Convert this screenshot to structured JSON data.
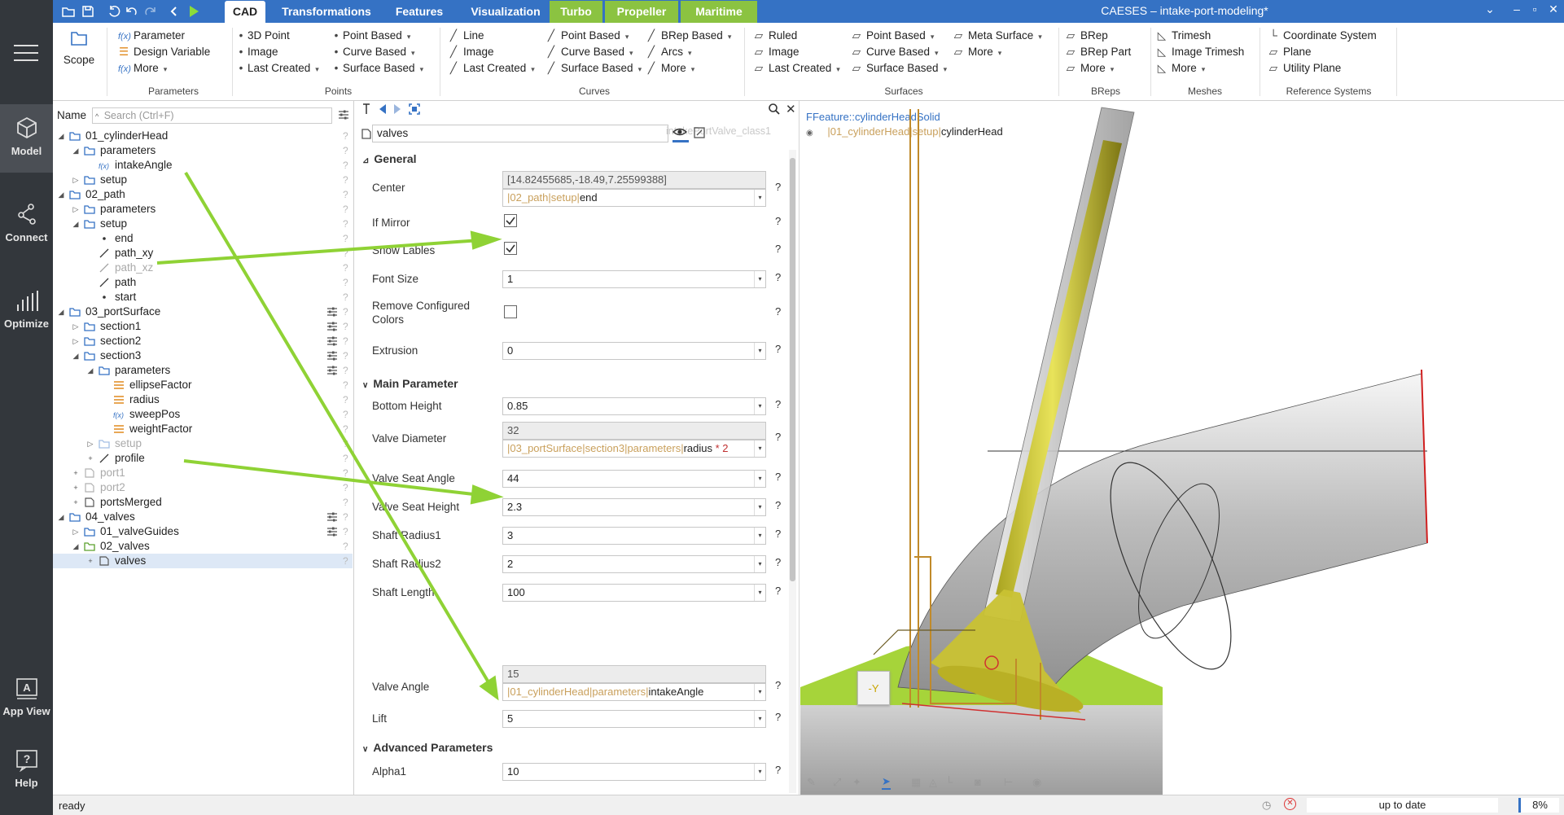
{
  "rail": {
    "items": [
      {
        "label": "Model",
        "icon": "cube-icon"
      },
      {
        "label": "Connect",
        "icon": "connect-icon"
      },
      {
        "label": "Optimize",
        "icon": "chart-icon"
      },
      {
        "label": "App View",
        "icon": "app-view-icon"
      },
      {
        "label": "Help",
        "icon": "help-icon"
      }
    ]
  },
  "titlebar": {
    "tabs": [
      "CAD",
      "Transformations",
      "Features",
      "Visualization",
      "Turbo",
      "Propeller",
      "Maritime"
    ],
    "title": "CAESES – intake-port-modeling*"
  },
  "ribbon": {
    "scope": "Scope",
    "params": {
      "parameter": "Parameter",
      "design_variable": "Design Variable",
      "more": "More",
      "group": "Parameters"
    },
    "points": {
      "p3d": "3D Point",
      "image": "Image",
      "last_created": "Last Created",
      "point_based": "Point Based",
      "curve_based": "Curve Based",
      "surface_based": "Surface Based",
      "group": "Points"
    },
    "curves": {
      "line": "Line",
      "image": "Image",
      "last_created": "Last Created",
      "point_based": "Point Based",
      "curve_based": "Curve Based",
      "surface_based": "Surface Based",
      "brep_based": "BRep Based",
      "arcs": "Arcs",
      "more": "More",
      "group": "Curves"
    },
    "surfaces": {
      "ruled": "Ruled",
      "image": "Image",
      "last_created": "Last Created",
      "point_based": "Point Based",
      "curve_based": "Curve Based",
      "surface_based": "Surface Based",
      "meta_surface": "Meta Surface",
      "more": "More",
      "group": "Surfaces"
    },
    "breps": {
      "brep": "BRep",
      "brep_part": "BRep Part",
      "more": "More",
      "group": "BReps"
    },
    "meshes": {
      "trimesh": "Trimesh",
      "image_trimesh": "Image Trimesh",
      "more": "More",
      "group": "Meshes"
    },
    "refsys": {
      "coordinate_system": "Coordinate System",
      "plane": "Plane",
      "utility_plane": "Utility Plane",
      "group": "Reference Systems"
    }
  },
  "tree": {
    "name_label": "Name",
    "search_placeholder": "Search (Ctrl+F)",
    "rows": [
      {
        "label": "01_cylinderHead",
        "icon": "folder-icon",
        "level": 0,
        "arrow": "expanded",
        "dim": false,
        "sliders": false
      },
      {
        "label": "parameters",
        "icon": "folder-icon",
        "level": 1,
        "arrow": "expanded",
        "dim": false,
        "sliders": false
      },
      {
        "label": "intakeAngle",
        "icon": "function-icon",
        "level": 2,
        "arrow": "none",
        "dim": false,
        "sliders": false
      },
      {
        "label": "setup",
        "icon": "folder-icon",
        "level": 1,
        "arrow": "collapsed",
        "dim": false,
        "sliders": false
      },
      {
        "label": "02_path",
        "icon": "folder-icon",
        "level": 0,
        "arrow": "expanded",
        "dim": false,
        "sliders": false
      },
      {
        "label": "parameters",
        "icon": "folder-icon",
        "level": 1,
        "arrow": "collapsed",
        "dim": false,
        "sliders": false
      },
      {
        "label": "setup",
        "icon": "folder-icon",
        "level": 1,
        "arrow": "expanded",
        "dim": false,
        "sliders": false
      },
      {
        "label": "end",
        "icon": "point-icon",
        "level": 2,
        "arrow": "none",
        "dim": false,
        "sliders": false
      },
      {
        "label": "path_xy",
        "icon": "curve-icon",
        "level": 2,
        "arrow": "none",
        "dim": false,
        "sliders": false
      },
      {
        "label": "path_xz",
        "icon": "curve-icon",
        "level": 2,
        "arrow": "none",
        "dim": true,
        "sliders": false
      },
      {
        "label": "path",
        "icon": "curve-icon",
        "level": 2,
        "arrow": "none",
        "dim": false,
        "sliders": false
      },
      {
        "label": "start",
        "icon": "point-icon",
        "level": 2,
        "arrow": "none",
        "dim": false,
        "sliders": false
      },
      {
        "label": "03_portSurface",
        "icon": "folder-icon",
        "level": 0,
        "arrow": "expanded",
        "dim": false,
        "sliders": true
      },
      {
        "label": "section1",
        "icon": "folder-icon",
        "level": 1,
        "arrow": "collapsed",
        "dim": false,
        "sliders": true
      },
      {
        "label": "section2",
        "icon": "folder-icon",
        "level": 1,
        "arrow": "collapsed",
        "dim": false,
        "sliders": true
      },
      {
        "label": "section3",
        "icon": "folder-icon",
        "level": 1,
        "arrow": "expanded",
        "dim": false,
        "sliders": true
      },
      {
        "label": "parameters",
        "icon": "folder-icon",
        "level": 2,
        "arrow": "expanded",
        "dim": false,
        "sliders": true
      },
      {
        "label": "ellipseFactor",
        "icon": "design-variable-icon",
        "level": 3,
        "arrow": "none",
        "dim": false,
        "sliders": false
      },
      {
        "label": "radius",
        "icon": "design-variable-icon",
        "level": 3,
        "arrow": "none",
        "dim": false,
        "sliders": false
      },
      {
        "label": "sweepPos",
        "icon": "function-icon",
        "level": 3,
        "arrow": "none",
        "dim": false,
        "sliders": false
      },
      {
        "label": "weightFactor",
        "icon": "design-variable-icon",
        "level": 3,
        "arrow": "none",
        "dim": false,
        "sliders": false
      },
      {
        "label": "setup",
        "icon": "folder-icon",
        "level": 2,
        "arrow": "collapsed",
        "dim": true,
        "sliders": false
      },
      {
        "label": "profile",
        "icon": "curve-icon",
        "level": 2,
        "arrow": "plus",
        "dim": false,
        "sliders": false
      },
      {
        "label": "port1",
        "icon": "surface-icon",
        "level": 1,
        "arrow": "plus",
        "dim": true,
        "sliders": false
      },
      {
        "label": "port2",
        "icon": "surface-icon",
        "level": 1,
        "arrow": "plus",
        "dim": true,
        "sliders": false
      },
      {
        "label": "portsMerged",
        "icon": "surface-icon",
        "level": 1,
        "arrow": "plus",
        "dim": false,
        "sliders": false
      },
      {
        "label": "04_valves",
        "icon": "folder-icon",
        "level": 0,
        "arrow": "expanded",
        "dim": false,
        "sliders": true
      },
      {
        "label": "01_valveGuides",
        "icon": "folder-icon",
        "level": 1,
        "arrow": "collapsed",
        "dim": false,
        "sliders": true
      },
      {
        "label": "02_valves",
        "icon": "folder-green-icon",
        "level": 1,
        "arrow": "expanded",
        "dim": false,
        "sliders": false
      },
      {
        "label": "valves",
        "icon": "surface-icon",
        "level": 2,
        "arrow": "plus",
        "dim": false,
        "sliders": false,
        "selected": true
      }
    ]
  },
  "props": {
    "class_name": "intakePortValve_class1",
    "object_name": "valves",
    "sections": {
      "general": "General",
      "main": "Main Parameter",
      "advanced": "Advanced Parameters"
    },
    "general": {
      "center_label": "Center",
      "center_value": "[14.82455685,-18.49,7.25599388]",
      "center_ref_path": "|02_path|setup|",
      "center_ref_name": "end",
      "if_mirror_label": "If Mirror",
      "if_mirror": true,
      "show_lables_label": "Show Lables",
      "show_lables": true,
      "font_size_label": "Font Size",
      "font_size": "1",
      "remove_colors_label": "Remove Configured Colors",
      "remove_colors": false,
      "extrusion_label": "Extrusion",
      "extrusion": "0"
    },
    "main": {
      "bottom_height_label": "Bottom Height",
      "bottom_height": "0.85",
      "valve_diameter_label": "Valve Diameter",
      "valve_diameter": "32",
      "valve_diameter_ref_path": "|03_portSurface|section3|parameters|",
      "valve_diameter_ref_name": "radius",
      "valve_diameter_ref_op": " * 2",
      "valve_seat_angle_label": "Valve Seat Angle",
      "valve_seat_angle": "44",
      "valve_seat_height_label": "Valve Seat Height",
      "valve_seat_height": "2.3",
      "shaft_radius1_label": "Shaft Radius1",
      "shaft_radius1": "3",
      "shaft_radius2_label": "Shaft Radius2",
      "shaft_radius2": "2",
      "shaft_length_label": "Shaft Length",
      "shaft_length": "100",
      "valve_angle_label": "Valve Angle",
      "valve_angle": "15",
      "valve_angle_ref_path": "|01_cylinderHead|parameters|",
      "valve_angle_ref_name": "intakeAngle",
      "lift_label": "Lift",
      "lift": "5"
    },
    "advanced": {
      "alpha1_label": "Alpha1",
      "alpha1": "10"
    },
    "qmark": "?"
  },
  "view": {
    "feature_label": "FFeature::cylinderHeadSolid",
    "path": "|01_cylinderHead|setup|",
    "path_name": "cylinderHead",
    "axis_label": "-Y"
  },
  "status": {
    "left": "ready",
    "state": "up to date",
    "zoom": "8%"
  },
  "colors": {
    "accent": "#3572c4",
    "green_tab": "#8bc341",
    "arrow": "#8fd235",
    "valve": "#c9c233"
  }
}
